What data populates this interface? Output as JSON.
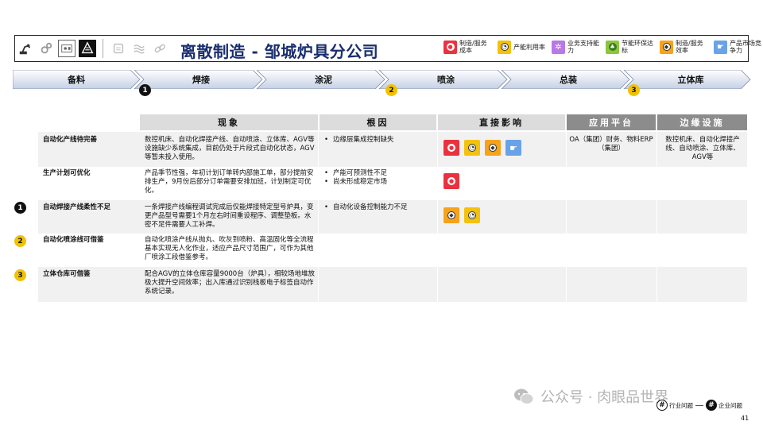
{
  "header": {
    "title": "离散制造 - 邹城炉具分公司",
    "icons": [
      "robot-arm-icon",
      "gears-icon",
      "machine-panel-icon",
      "factory-icon",
      "document-icon",
      "waves-icon",
      "chain-icon"
    ]
  },
  "legend": [
    {
      "label": "制造/服务成本",
      "icon": "cost-icon",
      "color": "#e8333f"
    },
    {
      "label": "产能利用率",
      "icon": "capacity-icon",
      "color": "#f4c20d"
    },
    {
      "label": "业务支持能力",
      "icon": "support-icon",
      "color": "#b878e6"
    },
    {
      "label": "节能环保达标",
      "icon": "eco-icon",
      "color": "#8cc63f"
    },
    {
      "label": "制造/服务效率",
      "icon": "efficiency-icon",
      "color": "#f6a21b"
    },
    {
      "label": "产品市场竞争力",
      "icon": "competitiveness-icon",
      "color": "#6aa2e8"
    }
  ],
  "process": {
    "steps": [
      "备料",
      "焊接",
      "涂泥",
      "喷涂",
      "总装",
      "立体库"
    ],
    "markers": [
      "1",
      "2",
      "3"
    ]
  },
  "table": {
    "headers": [
      "现象",
      "根因",
      "直接影响",
      "应用平台",
      "边缘设施"
    ],
    "rows": [
      {
        "marker": "",
        "title": "自动化产线待完善",
        "phenomenon": "数控机床、自动化焊接产线、自动喷涂、立体库、AGV等设施缺少系统集成，目前仍处于片段式自动化状态，AGV等暂未投入使用。",
        "causes": [
          "边缘层集成控制缺失"
        ],
        "impacts": [
          "cost-icon",
          "capacity-icon",
          "efficiency-icon",
          "competitiveness-icon"
        ],
        "platform": "OA（集团）财务、物料ERP（集团）",
        "edge": "数控机床、自动化焊接产线、自动喷涂、立体库、AGV等"
      },
      {
        "marker": "",
        "title": "生产计划可优化",
        "phenomenon": "产品季节性强，年初计划订单转内部施工单，部分提前安排生产，9月份后部分订单需要安排加班，计划制定可优化。",
        "causes": [
          "产能可预测性不足",
          "尚未形成稳定市场"
        ],
        "impacts": [
          "cost-icon"
        ],
        "platform": "",
        "edge": ""
      },
      {
        "marker": "1",
        "title": "自动焊接产线柔性不足",
        "phenomenon": "一条焊接产线编程调试完成后仅能焊接特定型号炉具，变更产品型号需要1个月左右时间重设程序、调整垫板。水密不足件需要人工补焊。",
        "causes": [
          "自动化设备控制能力不足"
        ],
        "impacts": [
          "efficiency-icon",
          "capacity-icon"
        ],
        "platform": "",
        "edge": ""
      },
      {
        "marker": "2",
        "title": "自动化喷涂线可借鉴",
        "phenomenon": "自动化喷涂产线从抛丸、吹灰到喷粉、高温固化等全流程基本实现无人化作业，适应产品尺寸范围广，可作为其他厂喷涂工段借鉴参考。",
        "causes": [],
        "impacts": [],
        "platform": "",
        "edge": ""
      },
      {
        "marker": "3",
        "title": "立体仓库可借鉴",
        "phenomenon": "配合AGV的立体仓库容量9000台（炉具），相较场地堆放极大提升空间效率；出入库通过识别栈板电子标签自动作系统记录。",
        "causes": [],
        "impacts": [],
        "platform": "",
        "edge": ""
      }
    ]
  },
  "watermark": "公众号 · 肉眼品世界",
  "footer_legend": {
    "industry_label": "行业问题",
    "enterprise_label": "企业问题",
    "symbol": "#"
  },
  "page_number": "41"
}
